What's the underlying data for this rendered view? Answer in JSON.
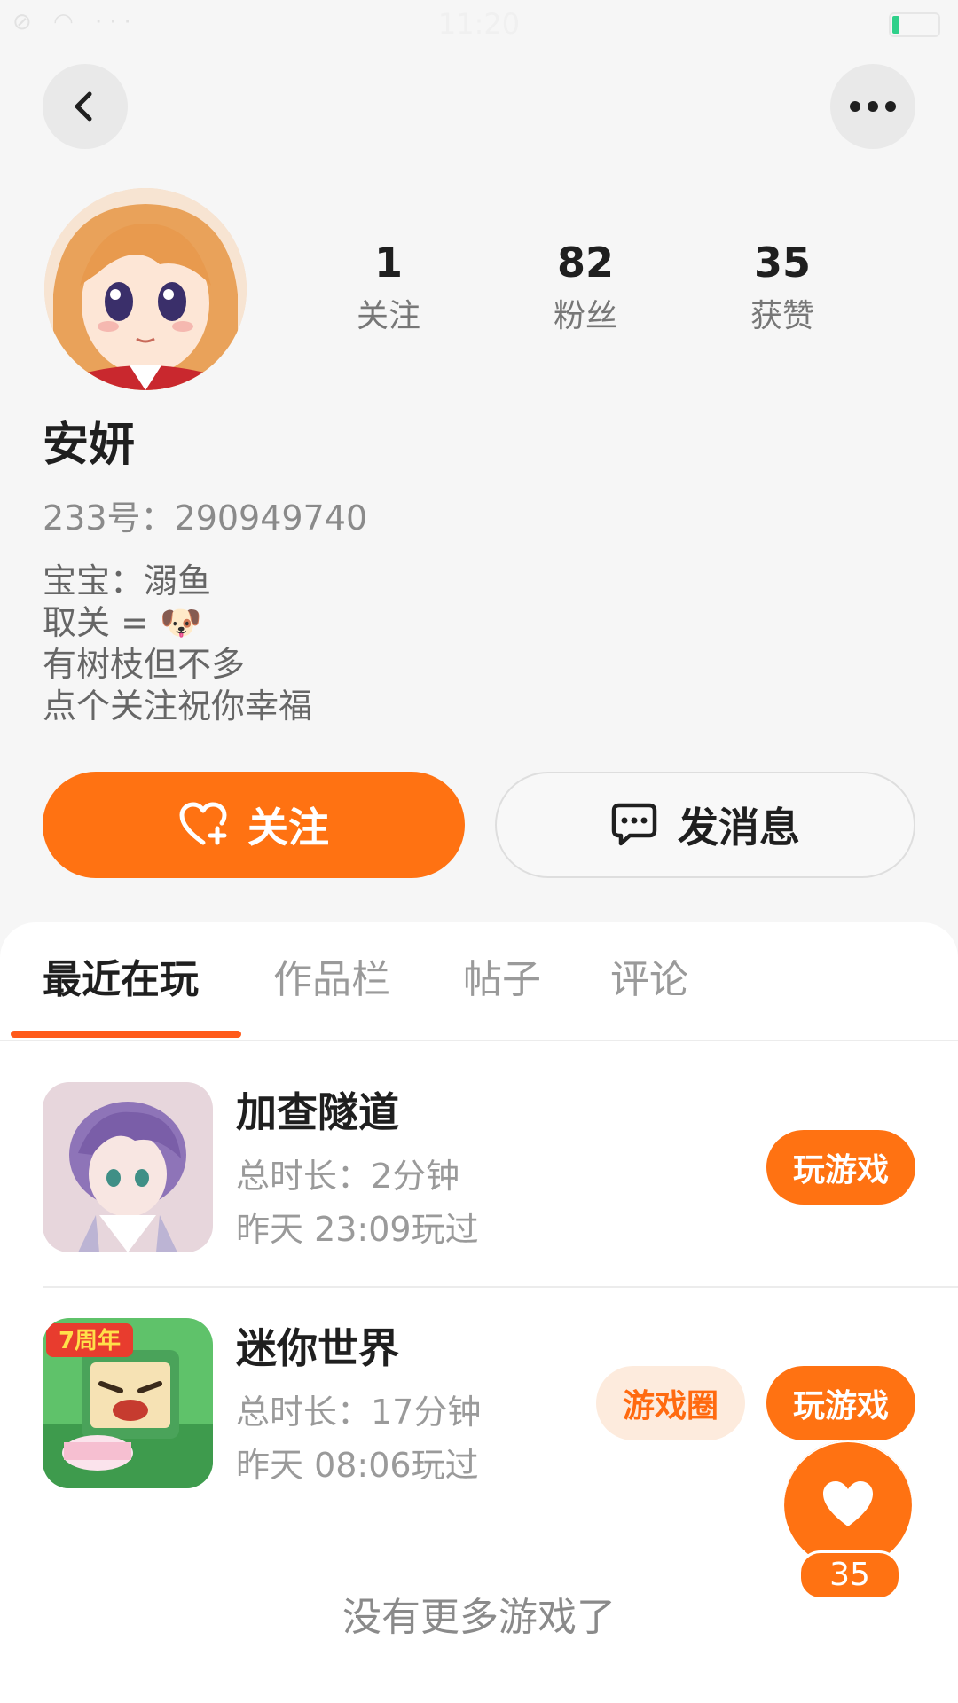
{
  "status_bar": {
    "time": "11:20",
    "icons": "⊘ ◠ ···"
  },
  "nav": {
    "back_icon": "chevron-left-icon",
    "more_icon": "more-horizontal-icon"
  },
  "profile": {
    "name": "安妍",
    "id_text": "233号：290949740",
    "bio": [
      "宝宝：溺鱼",
      "取关 = 🐶",
      "有树枝但不多",
      "点个关注祝你幸福"
    ],
    "stats": [
      {
        "value": "1",
        "label": "关注"
      },
      {
        "value": "82",
        "label": "粉丝"
      },
      {
        "value": "35",
        "label": "获赞"
      }
    ]
  },
  "actions": {
    "follow_label": "关注",
    "message_label": "发消息",
    "follow_icon": "heart-plus-icon",
    "message_icon": "chat-bubble-icon"
  },
  "tabs": [
    "最近在玩",
    "作品栏",
    "帖子",
    "评论"
  ],
  "games": [
    {
      "name": "加查隧道",
      "duration": "总时长：2分钟",
      "last_played": "昨天 23:09玩过",
      "play_label": "玩游戏"
    },
    {
      "name": "迷你世界",
      "duration": "总时长：17分钟",
      "last_played": "昨天 08:06玩过",
      "play_label": "玩游戏",
      "circle_label": "游戏圈",
      "badge_text": "7周年"
    }
  ],
  "footer": {
    "no_more": "没有更多游戏了"
  },
  "like_fab": {
    "count": "35",
    "icon": "heart-icon"
  },
  "colors": {
    "accent": "#ff7212",
    "indicator": "#ff5a1a",
    "chip_bg": "#fdebdd"
  }
}
